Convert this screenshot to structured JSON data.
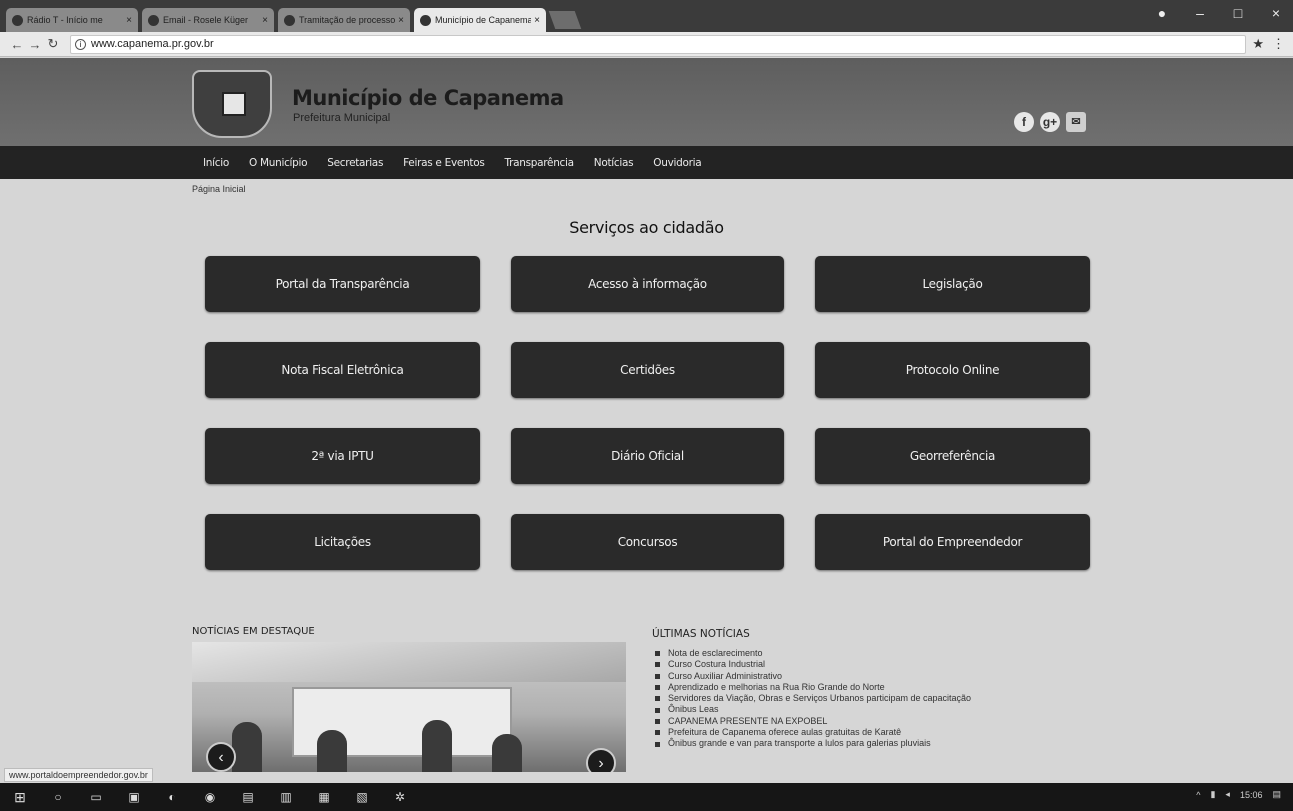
{
  "browser": {
    "tabs": [
      {
        "label": "Rádio T - Início me",
        "active": false
      },
      {
        "label": "Email - Rosele Küger",
        "active": false
      },
      {
        "label": "Tramitação de processo",
        "active": false
      },
      {
        "label": "Município de Capanema",
        "active": true
      }
    ],
    "url": "www.capanema.pr.gov.br"
  },
  "site": {
    "title": "Município de Capanema",
    "subtitle": "Prefeitura Municipal",
    "nav": [
      "Início",
      "O Município",
      "Secretarias",
      "Feiras e Eventos",
      "Transparência",
      "Notícias",
      "Ouvidoria"
    ],
    "breadcrumb": "Página Inicial",
    "social": [
      "f",
      "g+",
      "✉"
    ]
  },
  "services": {
    "title": "Serviços ao cidadão",
    "items": [
      "Portal da Transparência",
      "Acesso à informação",
      "Legislação",
      "Nota Fiscal Eletrônica",
      "Certidões",
      "Protocolo Online",
      "2ª via IPTU",
      "Diário Oficial",
      "Georreferência",
      "Licitações",
      "Concursos",
      "Portal do Empreendedor"
    ]
  },
  "highlights": {
    "title": "NOTÍCIAS EM DESTAQUE",
    "prev": "‹",
    "next": "›"
  },
  "latest_news": {
    "title": "ÚLTIMAS NOTÍCIAS",
    "items": [
      "Nota de esclarecimento",
      "Curso Costura Industrial",
      "Curso Auxiliar Administrativo",
      "Aprendizado e melhorias na Rua Rio Grande do Norte",
      "Servidores da Viação, Obras e Serviços Urbanos participam de capacitação",
      "Ônibus Leas",
      "CAPANEMA PRESENTE NA EXPOBEL",
      "Prefeitura de Capanema oferece aulas gratuitas de Karatê",
      "Ônibus grande e van para transporte a lulos para galerias pluviais"
    ]
  },
  "statusbar": "www.portaldoempreendedor.gov.br",
  "tray": {
    "time": "15:06"
  }
}
